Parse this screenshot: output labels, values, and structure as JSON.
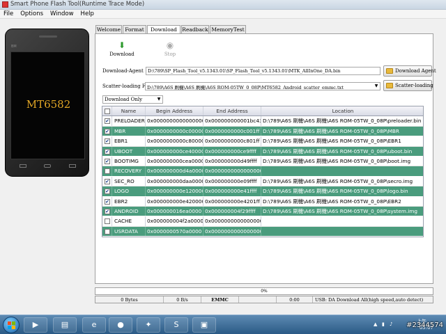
{
  "window": {
    "title": "Smart Phone Flash Tool(Runtime Trace Mode)"
  },
  "menu": [
    "File",
    "Options",
    "Window",
    "Help"
  ],
  "phone": {
    "brand": "BM",
    "chip": "MT6582"
  },
  "tabs": [
    "Welcome",
    "Format",
    "Download",
    "Readback",
    "MemoryTest"
  ],
  "active_tab": "Download",
  "toolbar": {
    "download": "Download",
    "stop": "Stop"
  },
  "download_agent": {
    "label": "Download-Agent",
    "value": "D:\\789\\SP_Flash_Tool_v5.1343.01\\SP_Flash_Tool_v5.1343.01\\MTK_AllInOne_DA.bin",
    "button": "Download Agent"
  },
  "scatter": {
    "label": "Scatter-loading File",
    "value": "D:\\789\\A6S 刷機\\A6S 刷機\\A6S ROM-05TW_0_08P\\MT6582_Android_scatter_emmc.txt",
    "button": "Scatter-loading"
  },
  "mode": "Download Only",
  "table": {
    "headers": [
      "Name",
      "Begin Address",
      "End Address",
      "Location"
    ],
    "rows": [
      {
        "checked": true,
        "name": "PRELOADER",
        "begin": "0x0000000000000000",
        "end": "0x000000000001bc43",
        "location": "D:\\789\\A6S 刷機\\A6S 刷機\\A6S ROM-05TW_0_08P\\preloader.bin"
      },
      {
        "checked": true,
        "name": "MBR",
        "begin": "0x0000000000c00000",
        "end": "0x0000000000c001ff",
        "location": "D:\\789\\A6S 刷機\\A6S 刷機\\A6S ROM-05TW_0_08P\\MBR"
      },
      {
        "checked": true,
        "name": "EBR1",
        "begin": "0x0000000000c80000",
        "end": "0x0000000000c801ff",
        "location": "D:\\789\\A6S 刷機\\A6S 刷機\\A6S ROM-05TW_0_08P\\EBR1"
      },
      {
        "checked": true,
        "name": "UBOOT",
        "begin": "0x000000000ce40000",
        "end": "0x000000000ce9ffff",
        "location": "D:\\789\\A6S 刷機\\A6S 刷機\\A6S ROM-05TW_0_08P\\uboot.bin"
      },
      {
        "checked": true,
        "name": "BOOTIMG",
        "begin": "0x000000000cea0000",
        "end": "0x000000000d49ffff",
        "location": "D:\\789\\A6S 刷機\\A6S 刷機\\A6S ROM-05TW_0_08P\\boot.img"
      },
      {
        "checked": false,
        "name": "RECOVERY",
        "begin": "0x000000000d4a0000",
        "end": "0x0000000000000000",
        "location": ""
      },
      {
        "checked": true,
        "name": "SEC_RO",
        "begin": "0x000000000daa0000",
        "end": "0x000000000e09ffff",
        "location": "D:\\789\\A6S 刷機\\A6S 刷機\\A6S ROM-05TW_0_08P\\secro.img"
      },
      {
        "checked": true,
        "name": "LOGO",
        "begin": "0x000000000e120000",
        "end": "0x000000000e41ffff",
        "location": "D:\\789\\A6S 刷機\\A6S 刷機\\A6S ROM-05TW_0_08P\\logo.bin"
      },
      {
        "checked": true,
        "name": "EBR2",
        "begin": "0x000000000e420000",
        "end": "0x000000000e4201ff",
        "location": "D:\\789\\A6S 刷機\\A6S 刷機\\A6S ROM-05TW_0_08P\\EBR2"
      },
      {
        "checked": true,
        "name": "ANDROID",
        "begin": "0x000000016ea0000",
        "end": "0x000000004f29ffff",
        "location": "D:\\789\\A6S 刷機\\A6S 刷機\\A6S ROM-05TW_0_08P\\system.img"
      },
      {
        "checked": false,
        "name": "CACHE",
        "begin": "0x000000004f2a0000",
        "end": "0x0000000000000000",
        "location": ""
      },
      {
        "checked": false,
        "name": "USRDATA",
        "begin": "0x0000000570a0000",
        "end": "0x0000000000000000",
        "location": ""
      }
    ]
  },
  "progress": {
    "text": "0%",
    "value": 0
  },
  "status": {
    "bytes": "0 Bytes",
    "rate": "0 B/s",
    "storage": "EMMC",
    "blank": "",
    "time": "0:00",
    "usb": "USB: DA Download All(high speed,auto detect)"
  },
  "tray": {
    "time": "05:07",
    "ampm": "上午",
    "watermark": "#2344574"
  },
  "colors": {
    "row_alt": "#4a9c7d",
    "taskbar": "#2a5a85"
  }
}
